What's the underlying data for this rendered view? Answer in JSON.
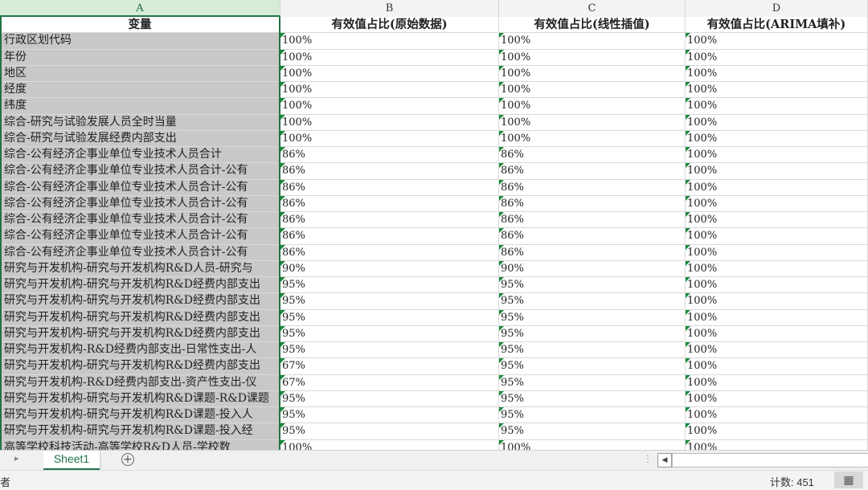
{
  "columns": [
    "A",
    "B",
    "C",
    "D"
  ],
  "header": {
    "a": "变量",
    "b": "有效值占比(原始数据)",
    "c": "有效值占比(线性插值)",
    "d": "有效值占比(ARIMA填补)"
  },
  "rows": [
    {
      "a": "行政区划代码",
      "b": "100%",
      "c": "100%",
      "d": "100%"
    },
    {
      "a": "年份",
      "b": "100%",
      "c": "100%",
      "d": "100%"
    },
    {
      "a": "地区",
      "b": "100%",
      "c": "100%",
      "d": "100%"
    },
    {
      "a": "经度",
      "b": "100%",
      "c": "100%",
      "d": "100%"
    },
    {
      "a": "纬度",
      "b": "100%",
      "c": "100%",
      "d": "100%"
    },
    {
      "a": "综合-研究与试验发展人员全时当量",
      "b": "100%",
      "c": "100%",
      "d": "100%"
    },
    {
      "a": "综合-研究与试验发展经费内部支出",
      "b": "100%",
      "c": "100%",
      "d": "100%"
    },
    {
      "a": "综合-公有经济企事业单位专业技术人员合计",
      "b": "86%",
      "c": "86%",
      "d": "100%"
    },
    {
      "a": "综合-公有经济企事业单位专业技术人员合计-公有",
      "b": "86%",
      "c": "86%",
      "d": "100%"
    },
    {
      "a": "综合-公有经济企事业单位专业技术人员合计-公有",
      "b": "86%",
      "c": "86%",
      "d": "100%"
    },
    {
      "a": "综合-公有经济企事业单位专业技术人员合计-公有",
      "b": "86%",
      "c": "86%",
      "d": "100%"
    },
    {
      "a": "综合-公有经济企事业单位专业技术人员合计-公有",
      "b": "86%",
      "c": "86%",
      "d": "100%"
    },
    {
      "a": "综合-公有经济企事业单位专业技术人员合计-公有",
      "b": "86%",
      "c": "86%",
      "d": "100%"
    },
    {
      "a": "综合-公有经济企事业单位专业技术人员合计-公有",
      "b": "86%",
      "c": "86%",
      "d": "100%"
    },
    {
      "a": "研究与开发机构-研究与开发机构R&D人员-研究与",
      "b": "90%",
      "c": "90%",
      "d": "100%"
    },
    {
      "a": "研究与开发机构-研究与开发机构R&D经费内部支出",
      "b": "95%",
      "c": "95%",
      "d": "100%"
    },
    {
      "a": "研究与开发机构-研究与开发机构R&D经费内部支出",
      "b": "95%",
      "c": "95%",
      "d": "100%"
    },
    {
      "a": "研究与开发机构-研究与开发机构R&D经费内部支出",
      "b": "95%",
      "c": "95%",
      "d": "100%"
    },
    {
      "a": "研究与开发机构-研究与开发机构R&D经费内部支出",
      "b": "95%",
      "c": "95%",
      "d": "100%"
    },
    {
      "a": "研究与开发机构-R&D经费内部支出-日常性支出-人",
      "b": "95%",
      "c": "95%",
      "d": "100%"
    },
    {
      "a": "研究与开发机构-研究与开发机构R&D经费内部支出",
      "b": "67%",
      "c": "95%",
      "d": "100%"
    },
    {
      "a": "研究与开发机构-R&D经费内部支出-资产性支出-仪",
      "b": "67%",
      "c": "95%",
      "d": "100%"
    },
    {
      "a": "研究与开发机构-研究与开发机构R&D课题-R&D课题",
      "b": "95%",
      "c": "95%",
      "d": "100%"
    },
    {
      "a": "研究与开发机构-研究与开发机构R&D课题-投入人",
      "b": "95%",
      "c": "95%",
      "d": "100%"
    },
    {
      "a": "研究与开发机构-研究与开发机构R&D课题-投入经",
      "b": "95%",
      "c": "95%",
      "d": "100%"
    },
    {
      "a": "高等学校科技活动-高等学校R&D人员-学校数",
      "b": "100%",
      "c": "100%",
      "d": "100%"
    }
  ],
  "tabs": {
    "sheet1": "Sheet1",
    "add": "+"
  },
  "status": {
    "left": "者",
    "count": "计数: 451"
  },
  "colors": {
    "accent": "#217346",
    "selected_col_bg": "#c8c8c8",
    "flag": "#1b8a3a"
  }
}
